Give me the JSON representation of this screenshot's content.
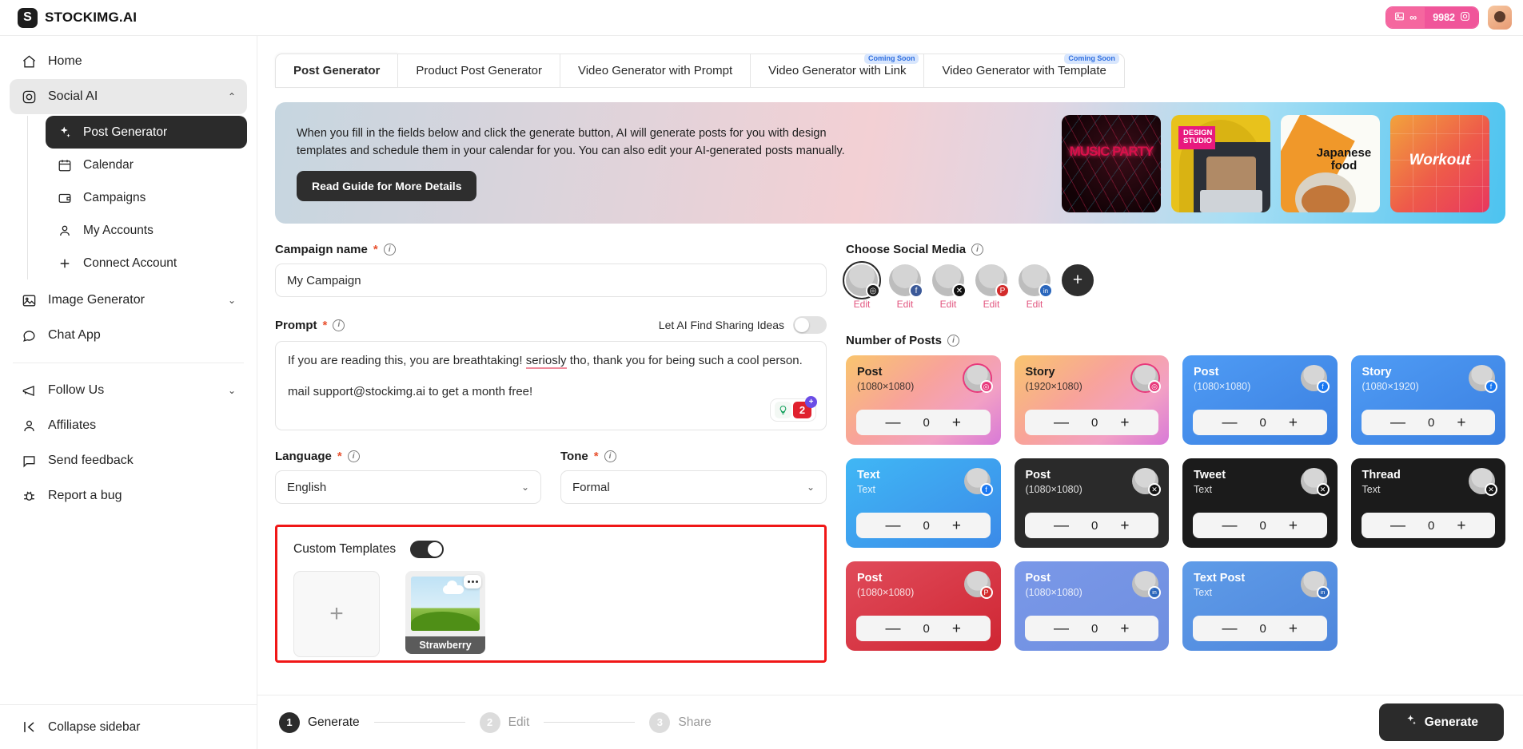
{
  "brand": {
    "mark": "S",
    "name": "STOCKIMG.AI"
  },
  "topbar": {
    "credits_left": "∞",
    "credits_right": "9982",
    "image_icon": "image-icon",
    "infinity_icon": "infinity-icon",
    "camera_icon": "camera-icon",
    "avatar": "user-avatar"
  },
  "sidebar": {
    "items": [
      {
        "label": "Home",
        "icon": "home-icon"
      },
      {
        "label": "Social AI",
        "icon": "instagram-icon",
        "expanded": true,
        "chevron": "⌃"
      },
      {
        "label": "Image Generator",
        "icon": "image-icon",
        "chevron": "⌄"
      },
      {
        "label": "Chat App",
        "icon": "chat-icon"
      }
    ],
    "sub_items": [
      {
        "label": "Post Generator",
        "icon": "sparkles-icon",
        "selected": true
      },
      {
        "label": "Calendar",
        "icon": "calendar-icon"
      },
      {
        "label": "Campaigns",
        "icon": "wallet-icon"
      },
      {
        "label": "My Accounts",
        "icon": "person-icon"
      },
      {
        "label": "Connect Account",
        "icon": "plus-icon"
      }
    ],
    "secondary_items": [
      {
        "label": "Follow Us",
        "icon": "megaphone-icon",
        "chevron": "⌄"
      },
      {
        "label": "Affiliates",
        "icon": "person-icon"
      },
      {
        "label": "Send feedback",
        "icon": "message-icon"
      },
      {
        "label": "Report a bug",
        "icon": "bug-icon"
      }
    ],
    "collapse": {
      "label": "Collapse sidebar",
      "icon": "collapse-icon"
    }
  },
  "tabs": [
    {
      "label": "Post Generator",
      "active": true,
      "badge": ""
    },
    {
      "label": "Product Post Generator",
      "active": false,
      "badge": ""
    },
    {
      "label": "Video Generator with Prompt",
      "active": false,
      "badge": ""
    },
    {
      "label": "Video Generator with Link",
      "active": false,
      "badge": "Coming Soon"
    },
    {
      "label": "Video Generator with Template",
      "active": false,
      "badge": "Coming Soon"
    }
  ],
  "banner": {
    "paragraph": "When you fill in the fields below and click the generate button, AI will generate posts for you with design templates and schedule them in your calendar for you. You can also edit your AI-generated posts manually.",
    "cta": "Read Guide for More Details",
    "thumbnails": [
      {
        "name": "music-party-template",
        "title": "MUSIC PARTY"
      },
      {
        "name": "design-studio-template",
        "title": "DESIGN STUDIO"
      },
      {
        "name": "japanese-food-template",
        "title": "Japanese food"
      },
      {
        "name": "workout-template",
        "title": "Workout"
      }
    ]
  },
  "form": {
    "campaign": {
      "label": "Campaign name",
      "required": "*",
      "value": "My Campaign",
      "placeholder": "My Campaign"
    },
    "prompt": {
      "label": "Prompt",
      "required": "*",
      "toggle_label": "Let AI Find Sharing Ideas",
      "toggle_on": false,
      "line1_a": "If you are reading this, you are breathtaking! ",
      "line1_spell": "seriosly",
      "line1_b": " tho, thank you for being such a cool person.",
      "line2": "mail support@stockimg.ai to get a month free!",
      "badge_bulb": "bulb-icon",
      "badge_count": "2",
      "badge_plus": "+"
    },
    "language": {
      "label": "Language",
      "required": "*",
      "value": "English"
    },
    "tone": {
      "label": "Tone",
      "required": "*",
      "value": "Formal"
    },
    "custom_templates": {
      "label": "Custom Templates",
      "toggle_on": true,
      "add_label": "+",
      "cards": [
        {
          "name": "Strawberry"
        }
      ]
    }
  },
  "social": {
    "label": "Choose Social Media",
    "accounts": [
      {
        "network": "instagram",
        "glyph": "◎",
        "color": "#1d1d1d",
        "edit": "Edit",
        "selected": true
      },
      {
        "network": "facebook",
        "glyph": "f",
        "color": "#3b5998",
        "edit": "Edit",
        "selected": false
      },
      {
        "network": "x",
        "glyph": "✕",
        "color": "#111111",
        "edit": "Edit",
        "selected": false
      },
      {
        "network": "pinterest",
        "glyph": "P",
        "color": "#d32b2b",
        "edit": "Edit",
        "selected": false
      },
      {
        "network": "linkedin",
        "glyph": "in",
        "color": "#2a66bc",
        "edit": "Edit",
        "selected": false
      }
    ],
    "add_label": "+"
  },
  "posts": {
    "label": "Number of Posts",
    "minus": "—",
    "plus": "+",
    "cards": [
      {
        "title": "Post",
        "size": "(1080×1080)",
        "count": "0",
        "network": "instagram",
        "glyph": "◎",
        "theme": "insta",
        "dark": false
      },
      {
        "title": "Story",
        "size": "(1920×1080)",
        "count": "0",
        "network": "instagram",
        "glyph": "◎",
        "theme": "insta",
        "dark": false
      },
      {
        "title": "Post",
        "size": "(1080×1080)",
        "count": "0",
        "network": "facebook",
        "glyph": "f",
        "theme": "fb",
        "dark": false
      },
      {
        "title": "Story",
        "size": "(1080×1920)",
        "count": "0",
        "network": "facebook",
        "glyph": "f",
        "theme": "fb",
        "dark": false
      },
      {
        "title": "Text",
        "size": "Text",
        "count": "0",
        "network": "facebook",
        "glyph": "f",
        "theme": "fbtext",
        "dark": false
      },
      {
        "title": "Post",
        "size": "(1080×1080)",
        "count": "0",
        "network": "x",
        "glyph": "✕",
        "theme": "xdark",
        "dark": true
      },
      {
        "title": "Tweet",
        "size": "Text",
        "count": "0",
        "network": "x",
        "glyph": "✕",
        "theme": "xdark",
        "dark": true
      },
      {
        "title": "Thread",
        "size": "Text",
        "count": "0",
        "network": "x",
        "glyph": "✕",
        "theme": "xdark",
        "dark": true
      },
      {
        "title": "Post",
        "size": "(1080×1080)",
        "count": "0",
        "network": "pinterest",
        "glyph": "P",
        "theme": "pin",
        "dark": true
      },
      {
        "title": "Post",
        "size": "(1080×1080)",
        "count": "0",
        "network": "linkedin",
        "glyph": "in",
        "theme": "li",
        "dark": false
      },
      {
        "title": "Text Post",
        "size": "Text",
        "count": "0",
        "network": "linkedin",
        "glyph": "in",
        "theme": "li",
        "dark": false
      }
    ]
  },
  "footer": {
    "steps": [
      {
        "num": "1",
        "label": "Generate",
        "active": true
      },
      {
        "num": "2",
        "label": "Edit",
        "active": false
      },
      {
        "num": "3",
        "label": "Share",
        "active": false
      }
    ],
    "generate_button": "Generate",
    "generate_icon": "sparkles-icon"
  }
}
